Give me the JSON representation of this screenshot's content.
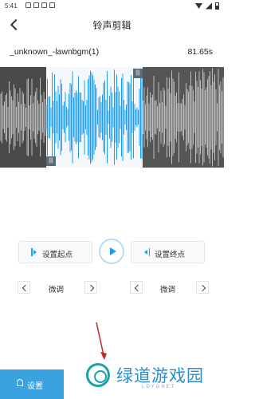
{
  "status": {
    "time": "5:41"
  },
  "header": {
    "title": "铃声剪辑"
  },
  "track": {
    "name": "_unknown_-lawnbgm(1)",
    "duration": "81.65s"
  },
  "controls": {
    "set_start_label": "设置起点",
    "set_end_label": "设置终点",
    "fine_tune_left_label": "微调",
    "fine_tune_right_label": "微调"
  },
  "bottom": {
    "settings_label": "设置"
  },
  "watermark": {
    "logo_text": "绿道游戏园",
    "logo_sub": "LDYGNET"
  },
  "colors": {
    "accent": "#1a9ff0",
    "waveform_selected": "#1a9ff0",
    "waveform_unselected": "#bdbdbd"
  },
  "icons": [
    "back-icon",
    "play-icon",
    "set-start-icon",
    "set-end-icon",
    "chevron-left-icon",
    "chevron-right-icon",
    "bell-icon"
  ]
}
